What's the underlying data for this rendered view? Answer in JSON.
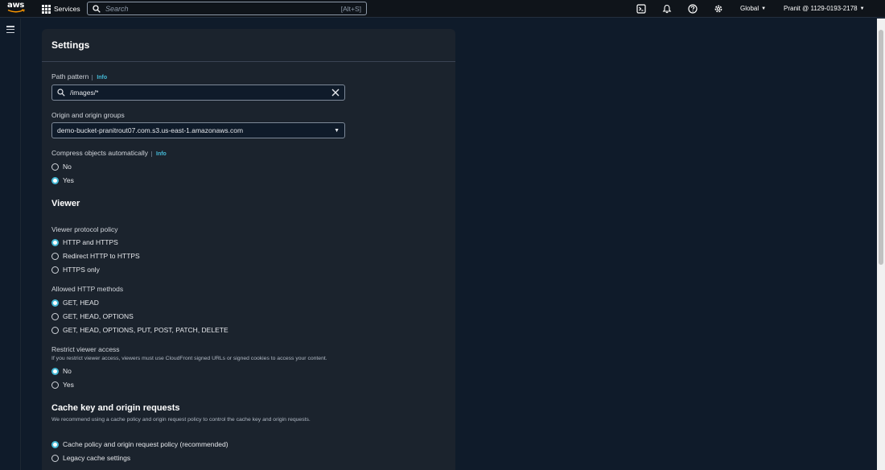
{
  "topnav": {
    "logo": "aws",
    "services_label": "Services",
    "search_placeholder": "Search",
    "search_shortcut": "[Alt+S]",
    "region_label": "Global",
    "account_label": "Pranit @ 1129-0193-2178"
  },
  "panel": {
    "title": "Settings",
    "path_pattern": {
      "label": "Path pattern",
      "info": "Info",
      "value": "/images/*"
    },
    "origin": {
      "label": "Origin and origin groups",
      "value": "demo-bucket-pranitrout07.com.s3.us-east-1.amazonaws.com"
    },
    "compress": {
      "label": "Compress objects automatically",
      "info": "Info",
      "options": [
        "No",
        "Yes"
      ],
      "selected": "Yes"
    },
    "viewer": {
      "title": "Viewer",
      "protocol": {
        "label": "Viewer protocol policy",
        "options": [
          "HTTP and HTTPS",
          "Redirect HTTP to HTTPS",
          "HTTPS only"
        ],
        "selected": "HTTP and HTTPS"
      },
      "methods": {
        "label": "Allowed HTTP methods",
        "options": [
          "GET, HEAD",
          "GET, HEAD, OPTIONS",
          "GET, HEAD, OPTIONS, PUT, POST, PATCH, DELETE"
        ],
        "selected": "GET, HEAD"
      },
      "restrict": {
        "label": "Restrict viewer access",
        "description": "If you restrict viewer access, viewers must use CloudFront signed URLs or signed cookies to access your content.",
        "options": [
          "No",
          "Yes"
        ],
        "selected": "No"
      }
    },
    "cache": {
      "title": "Cache key and origin requests",
      "description": "We recommend using a cache policy and origin request policy to control the cache key and origin requests.",
      "options": [
        "Cache policy and origin request policy (recommended)",
        "Legacy cache settings"
      ],
      "selected": "Cache policy and origin request policy (recommended)"
    }
  },
  "colors": {
    "accent": "#44b9d6",
    "background": "#0f1b2a",
    "panel": "#1b232d",
    "nav": "#0f141a"
  }
}
